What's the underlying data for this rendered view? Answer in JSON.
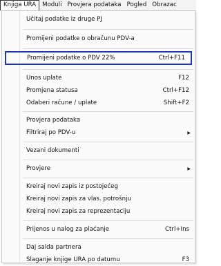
{
  "menubar": {
    "items": [
      {
        "label": "Knjiga URA"
      },
      {
        "label": "Moduli"
      },
      {
        "label": "Provjera podataka"
      },
      {
        "label": "Pogled"
      },
      {
        "label": "Obrazac"
      }
    ]
  },
  "dropdown": {
    "items": [
      {
        "label": "Učitaj podatke iz druge PJ",
        "shortcut": ""
      },
      {
        "label": "Promijeni podatke o obračunu PDV-a",
        "shortcut": ""
      },
      {
        "label": "Promijeni podatke o PDV 22%",
        "shortcut": "Ctrl+F11"
      },
      {
        "label": "Unos uplate",
        "shortcut": "F12"
      },
      {
        "label": "Promjena statusa",
        "shortcut": "Ctrl+F12"
      },
      {
        "label": "Odaberi račune / uplate",
        "shortcut": "Shift+F2"
      },
      {
        "label": "Provjera podataka",
        "shortcut": ""
      },
      {
        "label": "Filtriraj po PDV-u",
        "shortcut": ""
      },
      {
        "label": "Vezani dokumenti",
        "shortcut": ""
      },
      {
        "label": "Provjere",
        "shortcut": ""
      },
      {
        "label": "Kreiraj novi zapis iz postojećeg",
        "shortcut": ""
      },
      {
        "label": "Kreiraj novi zapis za vlas. potrošnju",
        "shortcut": ""
      },
      {
        "label": "Kreiraj novi zapis za reprezentaciju",
        "shortcut": ""
      },
      {
        "label": "Prijenos u nalog za plaćanje",
        "shortcut": "Ctrl+Ins"
      },
      {
        "label": "Daj salda partnera",
        "shortcut": ""
      },
      {
        "label": "Slaganje knjige URA po datumu",
        "shortcut": "F3"
      }
    ],
    "submenu_arrow": "▶",
    "highlight_color": "#2338a8"
  }
}
